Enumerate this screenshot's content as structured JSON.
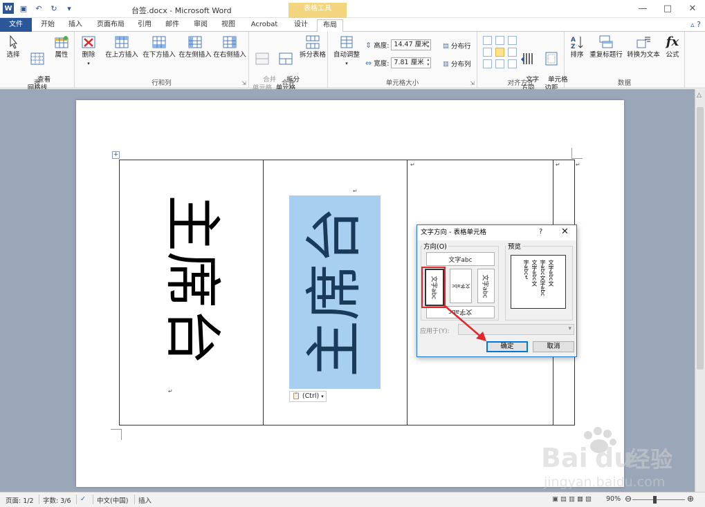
{
  "window": {
    "title": "台签.docx - Microsoft Word",
    "context_tab": "表格工具",
    "logo": "W",
    "controls": {
      "minimize": "—",
      "maximize": "□",
      "close": "✕"
    }
  },
  "qat": {
    "save": "▣",
    "undo": "↶",
    "redo": "↻",
    "more": "▾"
  },
  "tabs": {
    "file": "文件",
    "home": "开始",
    "insert": "插入",
    "page_layout": "页面布局",
    "references": "引用",
    "mailings": "邮件",
    "review": "审阅",
    "view": "视图",
    "acrobat": "Acrobat",
    "design": "设计",
    "layout": "布局",
    "help": "▵ ?"
  },
  "ribbon": {
    "table_group": {
      "label": "表",
      "select": "选择",
      "gridlines": "查看\n网格线",
      "properties": "属性"
    },
    "rows_cols_group": {
      "label": "行和列",
      "delete": "删除",
      "insert_above": "在上方插入",
      "insert_below": "在下方插入",
      "insert_left": "在左侧插入",
      "insert_right": "在右侧插入"
    },
    "merge_group": {
      "label": "合并",
      "merge_cells": "合并\n单元格",
      "split_cells": "拆分\n单元格",
      "split_table": "拆分表格"
    },
    "cell_size_group": {
      "label": "单元格大小",
      "autofit": "自动调整",
      "height_label": "高度:",
      "height_value": "14.47 厘米",
      "width_label": "宽度:",
      "width_value": "7.81 厘米",
      "distribute_rows": "分布行",
      "distribute_cols": "分布列"
    },
    "alignment_group": {
      "label": "对齐方式",
      "text_direction": "文字\n方向",
      "cell_margins": "单元格\n边距"
    },
    "data_group": {
      "label": "数据",
      "sort": "排序",
      "repeat_header": "重复标题行",
      "convert_to_text": "转换为文本",
      "formula": "公式",
      "fx": "fx"
    }
  },
  "document": {
    "cell1_text": "主席台",
    "cell2_text": "主席台",
    "paste_options": "(Ctrl)",
    "para_mark": "↵",
    "table_move": "+"
  },
  "dialog": {
    "title": "文字方向 - 表格单元格",
    "help": "?",
    "close": "✕",
    "orientation_label": "方向(O)",
    "options": {
      "horizontal": "文字abc",
      "vertical_right": "文字abc",
      "vertical_stacked": "文字abc",
      "vertical_left": "文字abc",
      "horizontal_bottom": "文字abc"
    },
    "preview_label": "预览",
    "preview_lines": [
      "文字abc文",
      "字abc文字abc",
      "文字abc文",
      "字abc↵"
    ],
    "apply_to_label": "应用于(Y):",
    "ok": "确定",
    "cancel": "取消"
  },
  "statusbar": {
    "page": "页面: 1/2",
    "words": "字数: 3/6",
    "language": "中文(中国)",
    "mode": "插入",
    "zoom": "90%",
    "zoom_out": "⊖",
    "zoom_in": "⊕"
  },
  "watermark": {
    "brand": "Bai",
    "brand2": "du",
    "brand3": "经验",
    "url": "jingyan.baidu.com"
  },
  "colors": {
    "word_blue": "#2b579a",
    "selection": "#a9cff0",
    "context_tab": "#f3d580",
    "highlight_red": "#e0262a"
  }
}
